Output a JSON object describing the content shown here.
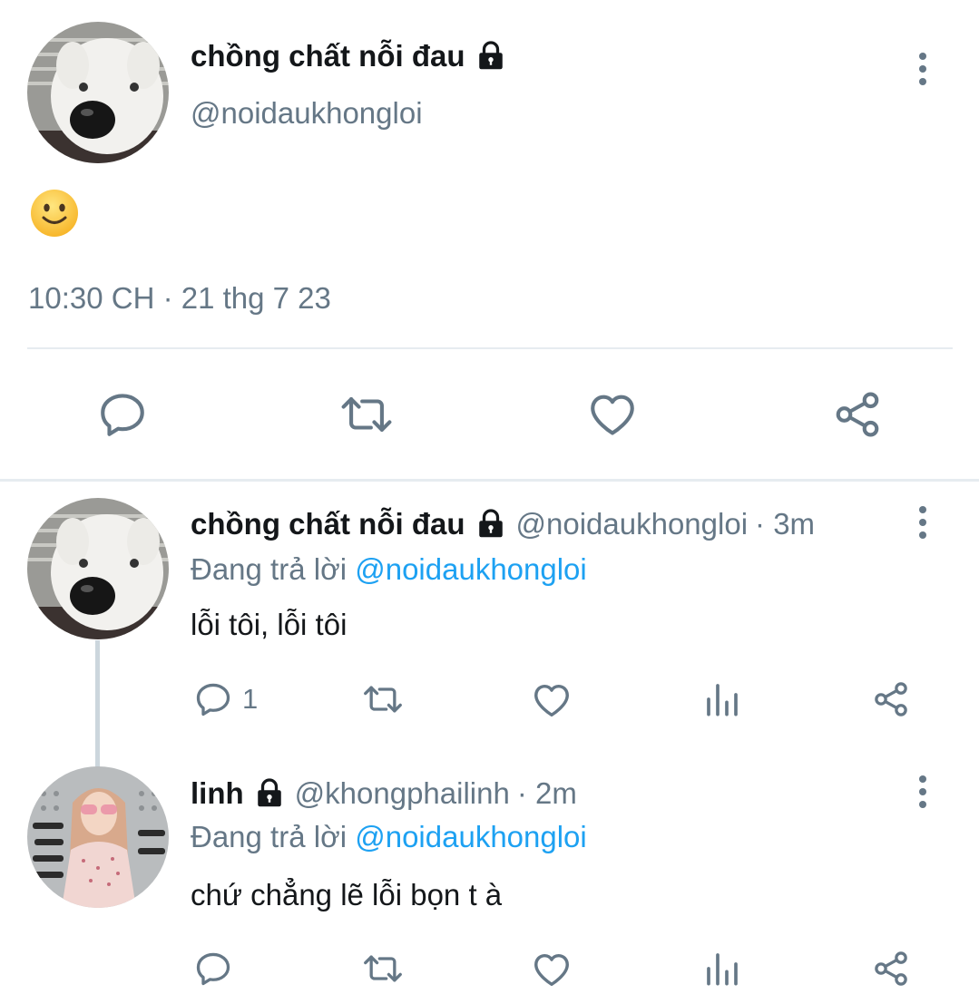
{
  "colors": {
    "accent": "#1da1f2",
    "muted": "#657786",
    "text": "#14171a",
    "divider": "#e6ecf0"
  },
  "main_tweet": {
    "display_name": "chồng chất nỗi đau",
    "handle": "@noidaukhongloi",
    "lock_icon": "lock-icon",
    "content_emoji": "🙂",
    "timestamp": "10:30 CH · 21 thg 7 23",
    "actions": [
      "reply-icon",
      "retweet-icon",
      "like-icon",
      "share-icon"
    ]
  },
  "replies": [
    {
      "display_name": "chồng chất nỗi đau",
      "handle": "@noidaukhongloi",
      "time": "· 3m",
      "replying_prefix": "Đang trả lời",
      "replying_to": "@noidaukhongloi",
      "text": "lỗi tôi, lỗi tôi",
      "reply_count": "1",
      "actions": [
        "reply-icon",
        "retweet-icon",
        "like-icon",
        "analytics-icon",
        "share-icon"
      ]
    },
    {
      "display_name": "linh",
      "handle": "@khongphailinh",
      "time": "· 2m",
      "replying_prefix": "Đang trả lời",
      "replying_to": "@noidaukhongloi",
      "text": "chứ chẳng lẽ lỗi bọn t à",
      "reply_count": "",
      "actions": [
        "reply-icon",
        "retweet-icon",
        "like-icon",
        "analytics-icon",
        "share-icon"
      ]
    }
  ]
}
